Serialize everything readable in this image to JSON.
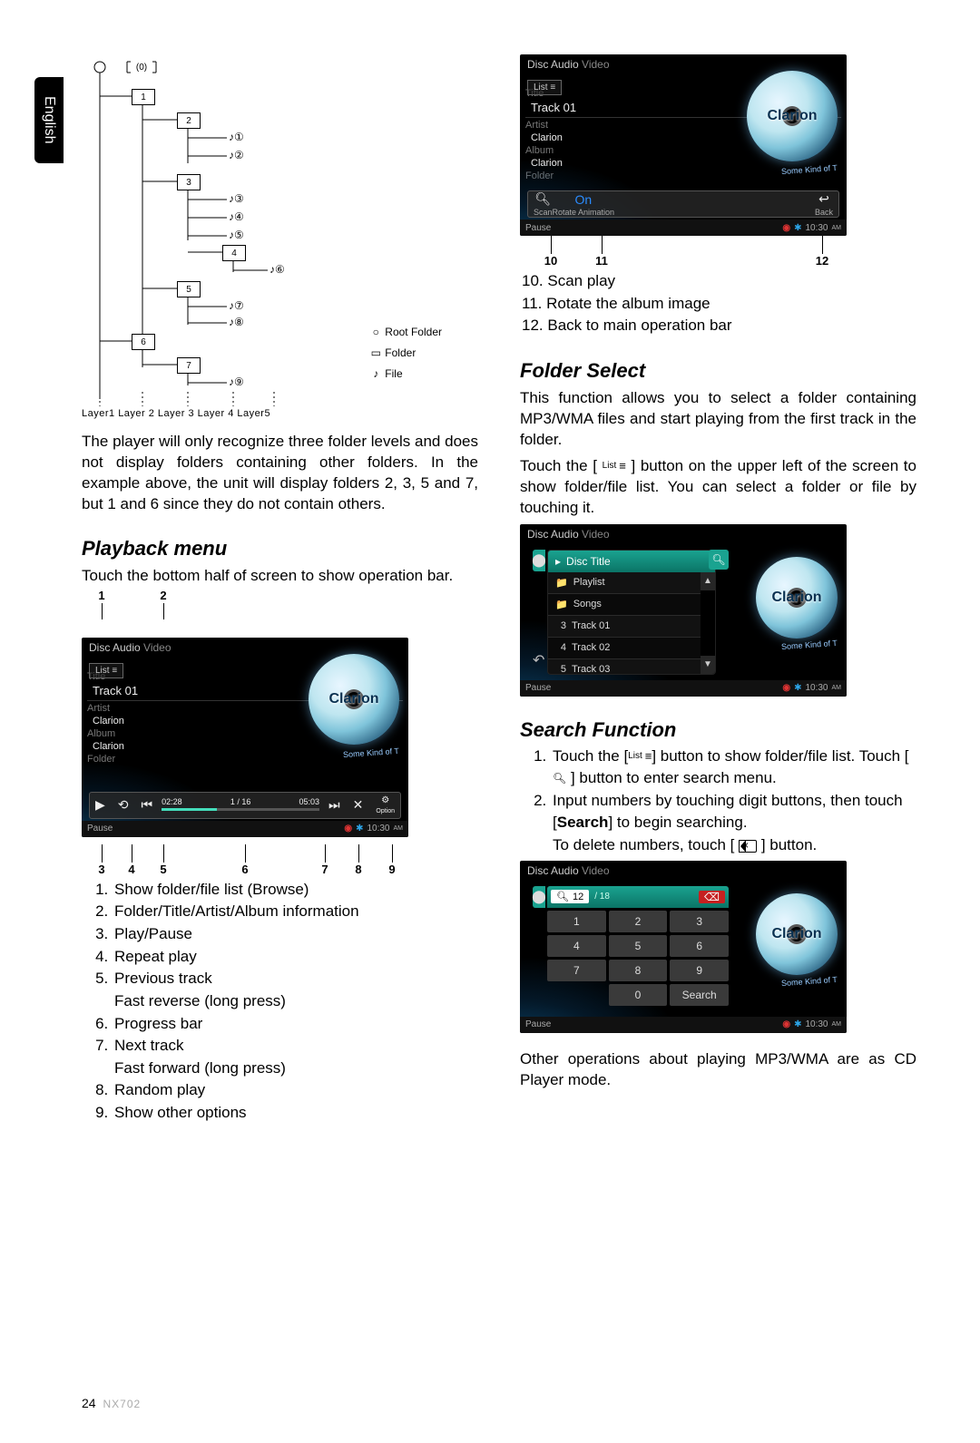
{
  "language_tab": "English",
  "page_number": "24",
  "model": "NX702",
  "tree": {
    "root_box": "0",
    "boxes": [
      "1",
      "2",
      "3",
      "4",
      "5",
      "6",
      "7"
    ],
    "files": [
      "①",
      "②",
      "③",
      "④",
      "⑤",
      "⑥",
      "⑦",
      "⑧",
      "⑨"
    ],
    "layer_row": "Layer1  Layer 2  Layer 3  Layer 4  Layer5",
    "legend": {
      "root": "Root Folder",
      "folder": "Folder",
      "file": "File"
    }
  },
  "para1": "The player will only recognize three folder levels and does not display folders containing other folders. In the example above, the unit will display folders 2, 3, 5 and 7, but 1 and 6 since they do not contain others.",
  "playback": {
    "heading": "Playback menu",
    "body": "Touch the bottom half of screen to show operation bar.",
    "markers_top": {
      "1": "1",
      "2": "2"
    },
    "markers_bottom": {
      "3": "3",
      "4": "4",
      "5": "5",
      "6": "6",
      "7": "7",
      "8": "8",
      "9": "9"
    },
    "list": [
      "Show folder/file list (Browse)",
      "Folder/Title/Artist/Album information",
      "Play/Pause",
      "Repeat play",
      "Previous track\nFast reverse (long press)",
      "Progress bar",
      "Next track\nFast forward (long press)",
      "Random play",
      "Show other options"
    ]
  },
  "screenshot_common": {
    "title_main": "Disc Audio",
    "title_sub": "Video",
    "list_label": "List",
    "labels": {
      "title": "Title",
      "artist": "Artist",
      "album": "Album",
      "folder": "Folder"
    },
    "track": "Track 01",
    "artist_val": "Clarion",
    "album_val": "Clarion",
    "disc_logo": "Clarion",
    "some_kind": "Some Kind of T",
    "status_left": "Pause",
    "time": "10:30",
    "ampm": "AM",
    "progress": {
      "elapsed": "02:28",
      "index": "1 / 16",
      "total": "05:03"
    }
  },
  "scan": {
    "markers": {
      "10": "10",
      "11": "11",
      "12": "12"
    },
    "scan_label": "Scan",
    "rotate_label": "Rotate Animation",
    "on_label": "On",
    "back_label": "Back",
    "list": [
      "Scan play",
      "Rotate the album image",
      "Back to main operation bar"
    ]
  },
  "folder_select": {
    "heading": "Folder Select",
    "body1": "This function allows you to select a folder containing MP3/WMA files and start playing from the first track in the folder.",
    "body2a": "Touch the [",
    "body2_list": "List",
    "body2b": "] button on the upper left of the screen to show folder/file list. You can select a folder or file by touching it.",
    "disc_title": "Disc Title",
    "rows": [
      {
        "icon": "📁",
        "label": "Playlist"
      },
      {
        "icon": "📁",
        "label": "Songs"
      },
      {
        "icon": "3",
        "label": "Track 01",
        "num": true
      },
      {
        "icon": "4",
        "label": "Track 02",
        "num": true
      },
      {
        "icon": "5",
        "label": "Track 03",
        "num": true
      }
    ]
  },
  "search": {
    "heading": "Search Function",
    "step1a": "Touch the [",
    "step1_list": "List",
    "step1b": "] button to show folder/file list. Touch [",
    "step1c": "] button to enter search menu.",
    "step2a": "Input numbers by touching digit buttons, then touch [",
    "step2_search": "Search",
    "step2b": "] to begin searching.",
    "step2c": "To delete numbers, touch [",
    "step2d": "] button.",
    "entered": "12",
    "count": "/ 18",
    "keys": [
      "1",
      "2",
      "3",
      "4",
      "5",
      "6",
      "7",
      "8",
      "9",
      "",
      "0",
      "Search"
    ],
    "footer": "Other operations about playing MP3/WMA are as CD Player mode."
  }
}
